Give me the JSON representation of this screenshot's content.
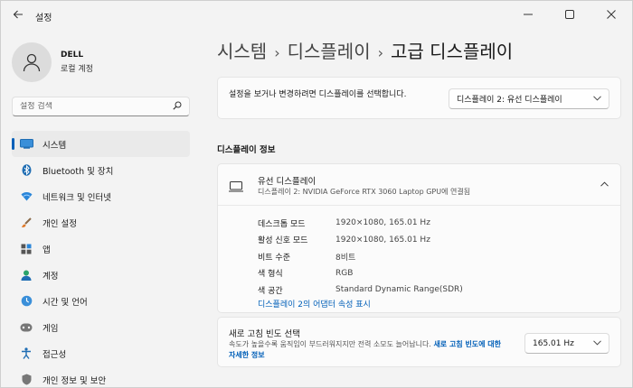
{
  "window": {
    "title": "설정",
    "back_icon": "arrow-left-icon",
    "controls": [
      "minimize",
      "maximize",
      "close"
    ]
  },
  "profile": {
    "name": "DELL",
    "account_type": "로컬 계정"
  },
  "search": {
    "placeholder": "설정 검색"
  },
  "sidebar": {
    "items": [
      {
        "label": "시스템",
        "icon": "monitor-icon",
        "active": true
      },
      {
        "label": "Bluetooth 및 장치",
        "icon": "bluetooth-icon",
        "active": false
      },
      {
        "label": "네트워크 및 인터넷",
        "icon": "wifi-icon",
        "active": false
      },
      {
        "label": "개인 설정",
        "icon": "brush-icon",
        "active": false
      },
      {
        "label": "앱",
        "icon": "apps-icon",
        "active": false
      },
      {
        "label": "계정",
        "icon": "person-icon",
        "active": false
      },
      {
        "label": "시간 및 언어",
        "icon": "globe-clock-icon",
        "active": false
      },
      {
        "label": "게임",
        "icon": "gamepad-icon",
        "active": false
      },
      {
        "label": "접근성",
        "icon": "accessibility-icon",
        "active": false
      },
      {
        "label": "개인 정보 및 보안",
        "icon": "shield-icon",
        "active": false
      }
    ]
  },
  "breadcrumb": {
    "items": [
      "시스템",
      "디스플레이",
      "고급 디스플레이"
    ],
    "separator": "›"
  },
  "display_select": {
    "description": "설정을 보거나 변경하려면 디스플레이를 선택합니다.",
    "selected": "디스플레이 2: 유선 디스플레이"
  },
  "display_info": {
    "section_title": "디스플레이 정보",
    "title": "유선 디스플레이",
    "subtitle": "디스플레이 2: NVIDIA GeForce RTX 3060 Laptop GPU에 연결됨",
    "properties": [
      {
        "key": "데스크톱 모드",
        "value": "1920×1080, 165.01 Hz"
      },
      {
        "key": "활성 신호 모드",
        "value": "1920×1080, 165.01 Hz"
      },
      {
        "key": "비트 수준",
        "value": "8비트"
      },
      {
        "key": "색 형식",
        "value": "RGB"
      },
      {
        "key": "색 공간",
        "value": "Standard Dynamic Range(SDR)"
      }
    ],
    "adapter_link": "디스플레이 2의 어댑터 속성 표시"
  },
  "refresh_rate": {
    "title": "새로 고침 빈도 선택",
    "description": "속도가 높을수록 움직임이 부드러워지지만 전력 소모도 늘어납니다.",
    "link": "새로 고침 빈도에 대한 자세한 정보",
    "selected": "165.01 Hz"
  },
  "colors": {
    "accent": "#005fb8",
    "background": "#f3f3f3",
    "card": "#fbfbfb"
  }
}
